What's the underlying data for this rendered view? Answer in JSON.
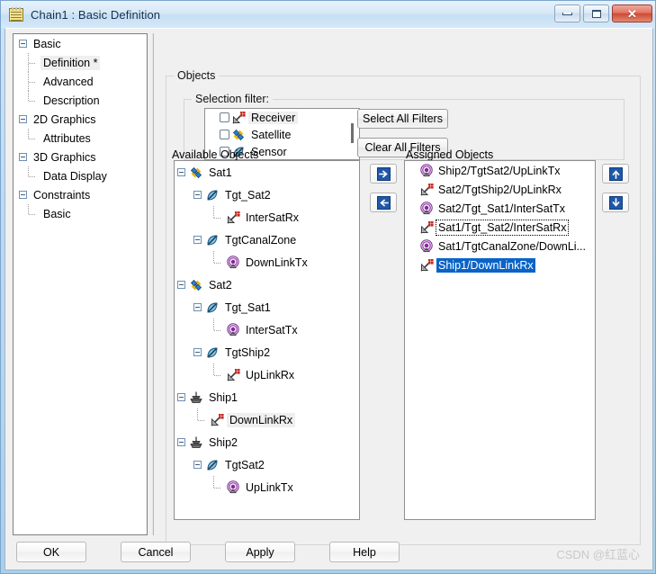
{
  "window": {
    "title": "Chain1 : Basic Definition",
    "icon": "notepad-icon",
    "minimize_label": "—",
    "maximize_label": "□",
    "close_label": "✕"
  },
  "tree": {
    "items": [
      {
        "label": "Basic",
        "level": 0,
        "expander": true,
        "selected": false,
        "last": false
      },
      {
        "label": "Definition *",
        "level": 1,
        "expander": false,
        "selected": true,
        "last": false
      },
      {
        "label": "Advanced",
        "level": 1,
        "expander": false,
        "selected": false,
        "last": false
      },
      {
        "label": "Description",
        "level": 1,
        "expander": false,
        "selected": false,
        "last": true
      },
      {
        "label": "2D Graphics",
        "level": 0,
        "expander": true,
        "selected": false,
        "last": false
      },
      {
        "label": "Attributes",
        "level": 1,
        "expander": false,
        "selected": false,
        "last": true
      },
      {
        "label": "3D Graphics",
        "level": 0,
        "expander": true,
        "selected": false,
        "last": false
      },
      {
        "label": "Data Display",
        "level": 1,
        "expander": false,
        "selected": false,
        "last": true
      },
      {
        "label": "Constraints",
        "level": 0,
        "expander": true,
        "selected": false,
        "last": false
      },
      {
        "label": "Basic",
        "level": 1,
        "expander": false,
        "selected": false,
        "last": true
      }
    ]
  },
  "objects_group": {
    "title": "Objects"
  },
  "selection_filter": {
    "title": "Selection filter:",
    "rows": [
      {
        "label": "Receiver",
        "checked": false,
        "icon": "receiver-icon",
        "highlight": true
      },
      {
        "label": "Satellite",
        "checked": false,
        "icon": "satellite-icon",
        "highlight": false
      },
      {
        "label": "Sensor",
        "checked": false,
        "icon": "sensor-icon",
        "highlight": false
      }
    ],
    "select_all_label": "Select All Filters",
    "clear_all_label": "Clear All Filters"
  },
  "available": {
    "label": "Available Objects",
    "items": [
      {
        "label": "Sat1",
        "level": 0,
        "expander": true,
        "icon": "satellite-icon",
        "highlight": false,
        "last": false
      },
      {
        "label": "Tgt_Sat2",
        "level": 1,
        "expander": true,
        "icon": "sensor-icon",
        "highlight": false,
        "last": false
      },
      {
        "label": "InterSatRx",
        "level": 2,
        "expander": false,
        "icon": "receiver-icon",
        "highlight": false,
        "last": true
      },
      {
        "label": "TgtCanalZone",
        "level": 1,
        "expander": true,
        "icon": "sensor-icon",
        "highlight": false,
        "last": true
      },
      {
        "label": "DownLinkTx",
        "level": 2,
        "expander": false,
        "icon": "transmitter-icon",
        "highlight": false,
        "last": true
      },
      {
        "label": "Sat2",
        "level": 0,
        "expander": true,
        "icon": "satellite-icon",
        "highlight": false,
        "last": false
      },
      {
        "label": "Tgt_Sat1",
        "level": 1,
        "expander": true,
        "icon": "sensor-icon",
        "highlight": false,
        "last": false
      },
      {
        "label": "InterSatTx",
        "level": 2,
        "expander": false,
        "icon": "transmitter-icon",
        "highlight": false,
        "last": true
      },
      {
        "label": "TgtShip2",
        "level": 1,
        "expander": true,
        "icon": "sensor-icon",
        "highlight": false,
        "last": true
      },
      {
        "label": "UpLinkRx",
        "level": 2,
        "expander": false,
        "icon": "receiver-icon",
        "highlight": false,
        "last": true
      },
      {
        "label": "Ship1",
        "level": 0,
        "expander": true,
        "icon": "ship-icon",
        "highlight": false,
        "last": false
      },
      {
        "label": "DownLinkRx",
        "level": 1,
        "expander": false,
        "icon": "receiver-icon",
        "highlight": true,
        "last": true
      },
      {
        "label": "Ship2",
        "level": 0,
        "expander": true,
        "icon": "ship-icon",
        "highlight": false,
        "last": true
      },
      {
        "label": "TgtSat2",
        "level": 1,
        "expander": true,
        "icon": "sensor-icon",
        "highlight": false,
        "last": true
      },
      {
        "label": "UpLinkTx",
        "level": 2,
        "expander": false,
        "icon": "transmitter-icon",
        "highlight": false,
        "last": true
      }
    ]
  },
  "assigned": {
    "label": "Assigned Objects",
    "items": [
      {
        "label": "Ship2/TgtSat2/UpLinkTx",
        "icon": "transmitter-icon",
        "selected": false,
        "focused": false
      },
      {
        "label": "Sat2/TgtShip2/UpLinkRx",
        "icon": "receiver-icon",
        "selected": false,
        "focused": false
      },
      {
        "label": "Sat2/Tgt_Sat1/InterSatTx",
        "icon": "transmitter-icon",
        "selected": false,
        "focused": false
      },
      {
        "label": "Sat1/Tgt_Sat2/InterSatRx",
        "icon": "receiver-icon",
        "selected": false,
        "focused": true
      },
      {
        "label": "Sat1/TgtCanalZone/DownLi...",
        "icon": "transmitter-icon",
        "selected": false,
        "focused": false
      },
      {
        "label": "Ship1/DownLinkRx",
        "icon": "receiver-icon",
        "selected": true,
        "focused": false
      }
    ]
  },
  "transfer_buttons": {
    "add": {
      "name": "move-right-button",
      "glyph": "arrow-right-icon"
    },
    "remove": {
      "name": "move-left-button",
      "glyph": "arrow-left-icon"
    }
  },
  "order_buttons": {
    "up": {
      "name": "move-up-button",
      "glyph": "arrow-up-icon"
    },
    "down": {
      "name": "move-down-button",
      "glyph": "arrow-down-icon"
    }
  },
  "footer": {
    "ok": "OK",
    "cancel": "Cancel",
    "apply": "Apply",
    "help": "Help",
    "watermark": "CSDN @红蓝心"
  },
  "colors": {
    "accent_blue": "#1f58a6",
    "selection_blue": "#0a64c8",
    "titlebar": "#d6e8f7",
    "window_frame": "#aacfea",
    "panel_bg": "#f0f0f0"
  }
}
